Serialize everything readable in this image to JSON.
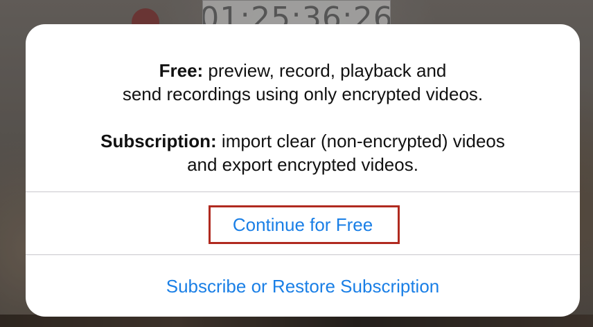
{
  "background": {
    "timecode": "01:25:36:26"
  },
  "dialog": {
    "free_label": "Free:",
    "free_text": " preview, record, playback and",
    "free_text_line2": "send recordings using only encrypted videos.",
    "subscription_label": "Subscription:",
    "subscription_text": " import clear (non-encrypted) videos",
    "subscription_text_line2": "and export encrypted videos.",
    "actions": {
      "continue_free": "Continue for Free",
      "subscribe": "Subscribe or Restore Subscription"
    }
  },
  "colors": {
    "action_blue": "#1a7fe6",
    "highlight_red": "#b02a1f"
  }
}
